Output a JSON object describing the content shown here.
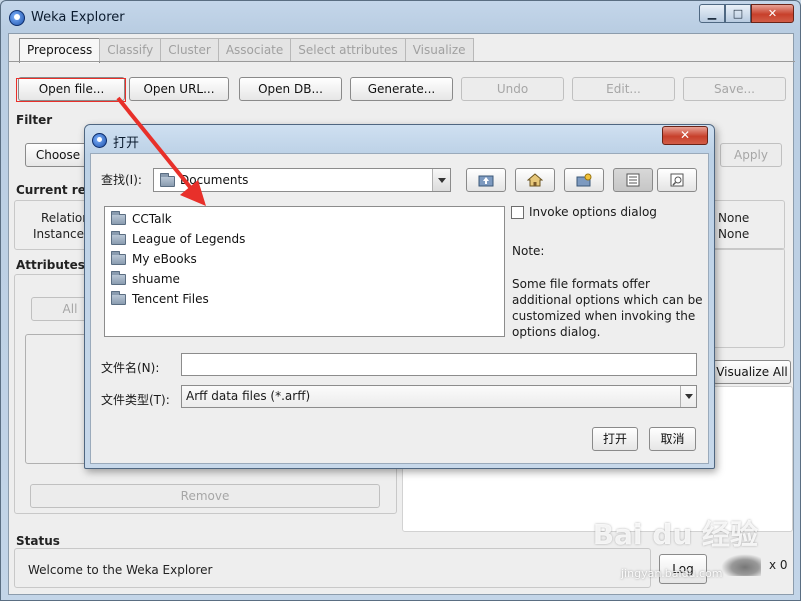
{
  "window": {
    "title": "Weka Explorer"
  },
  "tabs": [
    "Preprocess",
    "Classify",
    "Cluster",
    "Associate",
    "Select attributes",
    "Visualize"
  ],
  "toolbar": {
    "open_file": "Open file...",
    "open_url": "Open URL...",
    "open_db": "Open DB...",
    "generate": "Generate...",
    "undo": "Undo",
    "edit": "Edit...",
    "save": "Save..."
  },
  "filter": {
    "label": "Filter",
    "choose": "Choose",
    "apply": "Apply"
  },
  "current_relation": {
    "label": "Current rela",
    "relation": "Relation",
    "instances": "Instances",
    "relation_value": "None",
    "instances_value": "None"
  },
  "attributes": {
    "label": "Attributes",
    "all": "All",
    "remove": "Remove",
    "visualize_all": "Visualize All"
  },
  "status": {
    "label": "Status",
    "text": "Welcome to the Weka Explorer",
    "log": "Log",
    "x_count": "x 0"
  },
  "dialog": {
    "title": "打开",
    "look_in_label": "查找(I):",
    "look_in_value": "Documents",
    "files": [
      "CCTalk",
      "League of Legends",
      "My eBooks",
      "shuame",
      "Tencent Files"
    ],
    "invoke_options": "Invoke options dialog",
    "note_title": "Note:",
    "note_body": "Some file formats offer additional options which can be customized when invoking the options dialog.",
    "file_name_label": "文件名(N):",
    "file_name_value": "",
    "file_type_label": "文件类型(T):",
    "file_type_value": "Arff data files (*.arff)",
    "open_button": "打开",
    "cancel_button": "取消"
  },
  "watermark": {
    "brand": "Bai du 经验",
    "url": "jingyan.baidu.com"
  },
  "colors": {
    "annotation_red": "#e8302a",
    "accent": "#1c4fa8"
  }
}
